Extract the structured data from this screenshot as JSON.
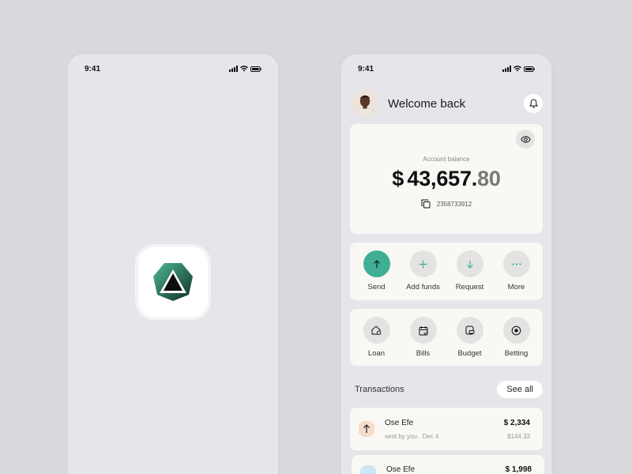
{
  "left_phone": {
    "status": {
      "time": "9:41"
    }
  },
  "right_phone": {
    "status": {
      "time": "9:41"
    },
    "header": {
      "welcome": "Welcome back"
    },
    "balance": {
      "label": "Account balance",
      "currency": "$",
      "amount_main": "43,657.",
      "amount_cents": "80",
      "account_number": "2358733912"
    },
    "actions": [
      {
        "label": "Send",
        "icon": "arrow-up-icon"
      },
      {
        "label": "Add funds",
        "icon": "plus-icon"
      },
      {
        "label": "Request",
        "icon": "arrow-down-icon"
      },
      {
        "label": "More",
        "icon": "more-icon"
      }
    ],
    "services": [
      {
        "label": "Loan",
        "icon": "house-icon"
      },
      {
        "label": "Bills",
        "icon": "calendar-icon"
      },
      {
        "label": "Budget",
        "icon": "wallet-icon"
      },
      {
        "label": "Betting",
        "icon": "target-icon"
      }
    ],
    "transactions": {
      "title": "Transactions",
      "see_all": "See all",
      "items": [
        {
          "name": "Ose Efe",
          "sub": "sent by you . Dec 4",
          "amount": "$ 2,334",
          "amount_secondary": "$144.33"
        },
        {
          "name": "Ose Efe",
          "amount": "$ 1,998"
        }
      ]
    }
  },
  "colors": {
    "accent": "#3fae94",
    "background": "#d9d8dc",
    "phone": "#e6e5e9",
    "card": "#f9f8f5"
  }
}
